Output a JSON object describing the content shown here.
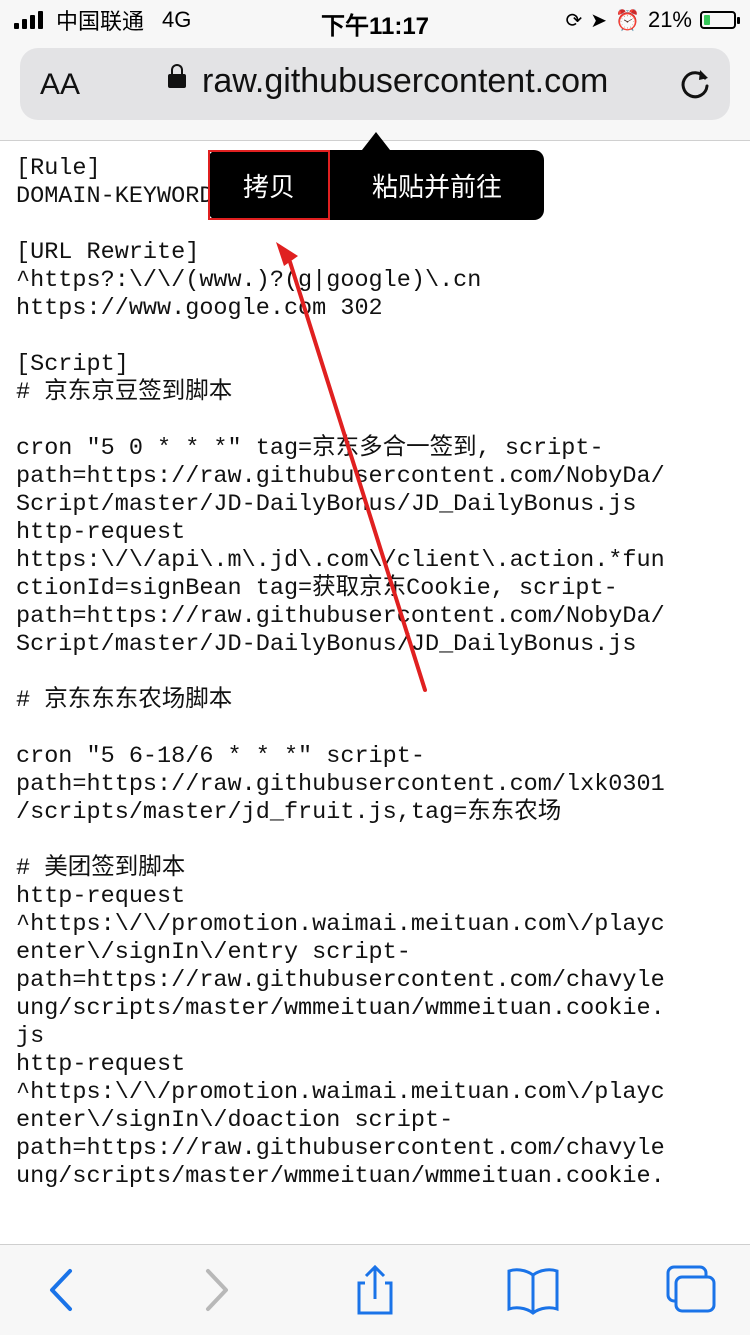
{
  "status_bar": {
    "carrier": "中国联通",
    "network": "4G",
    "time": "下午11:17",
    "battery_percent": "21%",
    "battery_level": 0.21,
    "battery_color": "#36c759"
  },
  "url_bar": {
    "aa_label": "AA",
    "url": "raw.githubusercontent.com"
  },
  "popup": {
    "copy_label": "拷贝",
    "paste_go_label": "粘贴并前往",
    "highlight_color": "#e02020"
  },
  "annotation": {
    "arrow_color": "#e02020"
  },
  "content": {
    "lines": [
      "[Rule]",
      "DOMAIN-KEYWORD,",
      "",
      "[URL Rewrite]",
      "^https?:\\/\\/(www.)?(g|google)\\.cn",
      "https://www.google.com 302",
      "",
      "[Script]",
      "# 京东京豆签到脚本",
      "",
      "cron \"5 0 * * *\" tag=京东多合一签到, script-",
      "path=https://raw.githubusercontent.com/NobyDa/",
      "Script/master/JD-DailyBonus/JD_DailyBonus.js",
      "http-request",
      "https:\\/\\/api\\.m\\.jd\\.com\\/client\\.action.*fun",
      "ctionId=signBean tag=获取京东Cookie, script-",
      "path=https://raw.githubusercontent.com/NobyDa/",
      "Script/master/JD-DailyBonus/JD_DailyBonus.js",
      "",
      "# 京东东东农场脚本",
      "",
      "cron \"5 6-18/6 * * *\" script-",
      "path=https://raw.githubusercontent.com/lxk0301",
      "/scripts/master/jd_fruit.js,tag=东东农场",
      "",
      "# 美团签到脚本",
      "http-request",
      "^https:\\/\\/promotion.waimai.meituan.com\\/playc",
      "enter\\/signIn\\/entry script-",
      "path=https://raw.githubusercontent.com/chavyle",
      "ung/scripts/master/wmmeituan/wmmeituan.cookie.",
      "js",
      "http-request",
      "^https:\\/\\/promotion.waimai.meituan.com\\/playc",
      "enter\\/signIn\\/doaction script-",
      "path=https://raw.githubusercontent.com/chavyle",
      "ung/scripts/master/wmmeituan/wmmeituan.cookie."
    ]
  },
  "toolbar": {
    "icons": [
      "back-icon",
      "forward-icon",
      "share-icon",
      "bookmarks-icon",
      "tabs-icon"
    ],
    "accent_color": "#1a73e8"
  }
}
